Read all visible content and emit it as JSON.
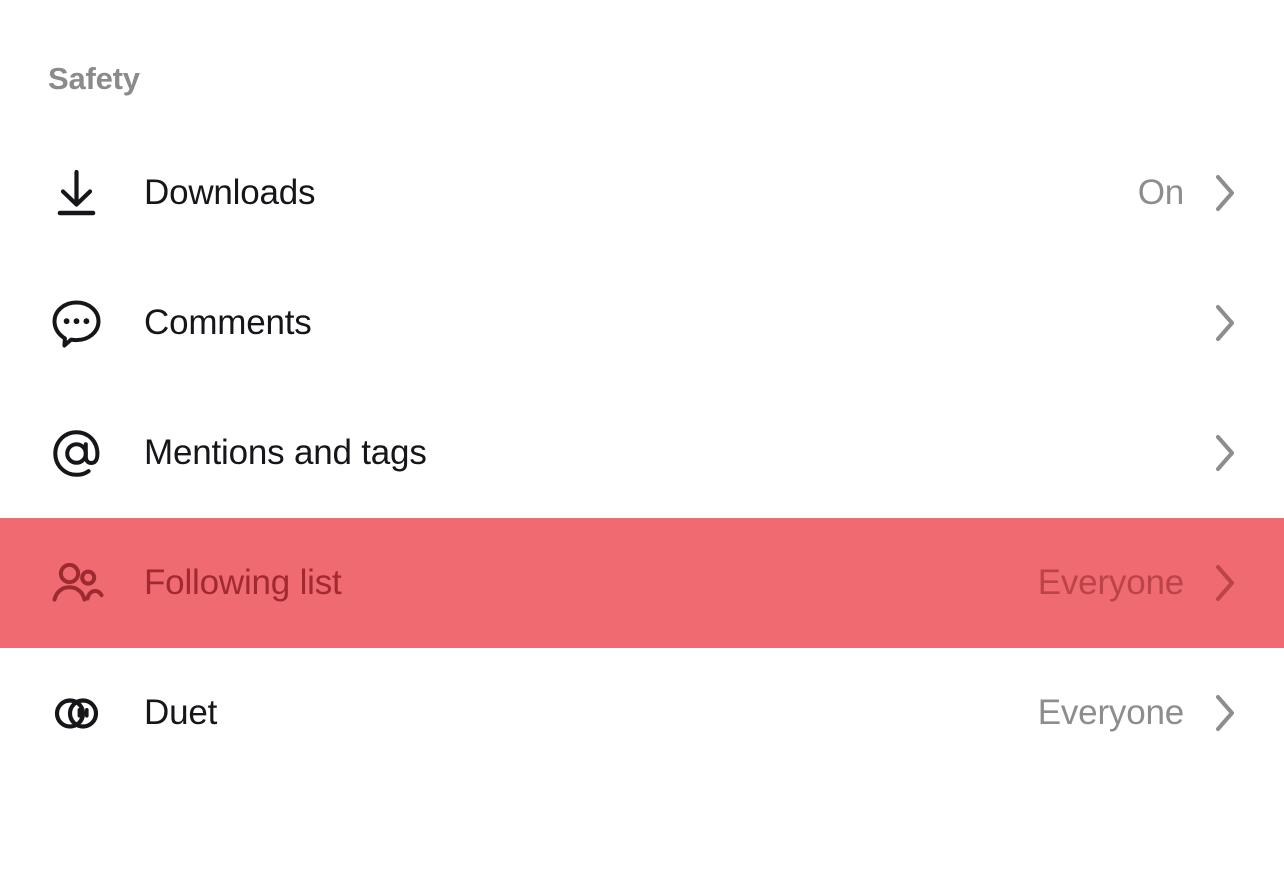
{
  "section": {
    "title": "Safety"
  },
  "colors": {
    "background": "#ffffff",
    "highlight": "#ef6a71",
    "label": "#16161a",
    "muted": "#8d8d8d",
    "section_header": "#8b8b8b",
    "highlight_label": "#a02a30",
    "highlight_muted": "#bc4449"
  },
  "rows": [
    {
      "icon": "download-icon",
      "label": "Downloads",
      "value": "On",
      "chevron": "chevron-right-icon",
      "highlighted": false
    },
    {
      "icon": "comment-bubble-icon",
      "label": "Comments",
      "value": "",
      "chevron": "chevron-right-icon",
      "highlighted": false
    },
    {
      "icon": "at-mention-icon",
      "label": "Mentions and tags",
      "value": "",
      "chevron": "chevron-right-icon",
      "highlighted": false
    },
    {
      "icon": "two-people-icon",
      "label": "Following list",
      "value": "Everyone",
      "chevron": "chevron-right-icon",
      "highlighted": true
    },
    {
      "icon": "duet-circles-icon",
      "label": "Duet",
      "value": "Everyone",
      "chevron": "chevron-right-icon",
      "highlighted": false
    }
  ]
}
